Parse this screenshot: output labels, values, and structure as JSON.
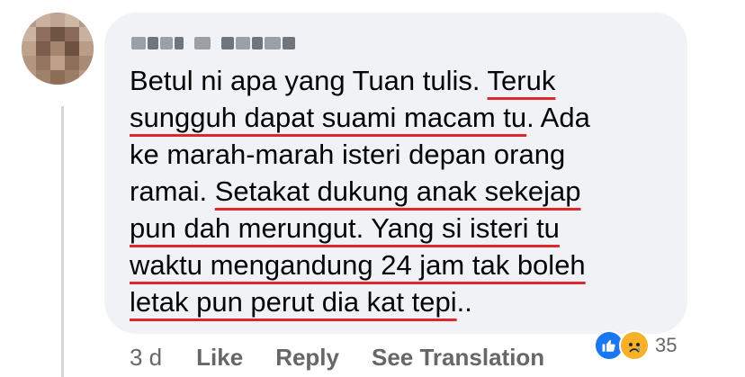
{
  "comment": {
    "author": "",
    "lines": [
      {
        "plain": "Betul ni apa yang Tuan tulis. ",
        "underlined": "Teruk",
        "tail": ""
      },
      {
        "plain": "",
        "underlined": "sungguh dapat suami macam tu",
        "tail": ". Ada"
      },
      {
        "plain": "ke marah-marah isteri depan orang",
        "underlined": "",
        "tail": ""
      },
      {
        "plain": "ramai. ",
        "underlined": "Setakat dukung anak sekejap",
        "tail": ""
      },
      {
        "plain": "",
        "underlined": "pun dah merungut. Yang si isteri tu",
        "tail": ""
      },
      {
        "plain": "",
        "underlined": "waktu mengandung 24 jam tak boleh",
        "tail": ""
      },
      {
        "plain": "",
        "underlined": "letak pun perut dia kat tepi",
        "tail": ".."
      }
    ],
    "underline_color": "#e0262d"
  },
  "actions": {
    "time": "3 d",
    "like": "Like",
    "reply": "Reply",
    "see_translation": "See Translation"
  },
  "reactions": {
    "icons": [
      "like-icon",
      "sad-icon"
    ],
    "count": "35",
    "like_color": "#1877f2",
    "sad_color": "#f7b125"
  }
}
